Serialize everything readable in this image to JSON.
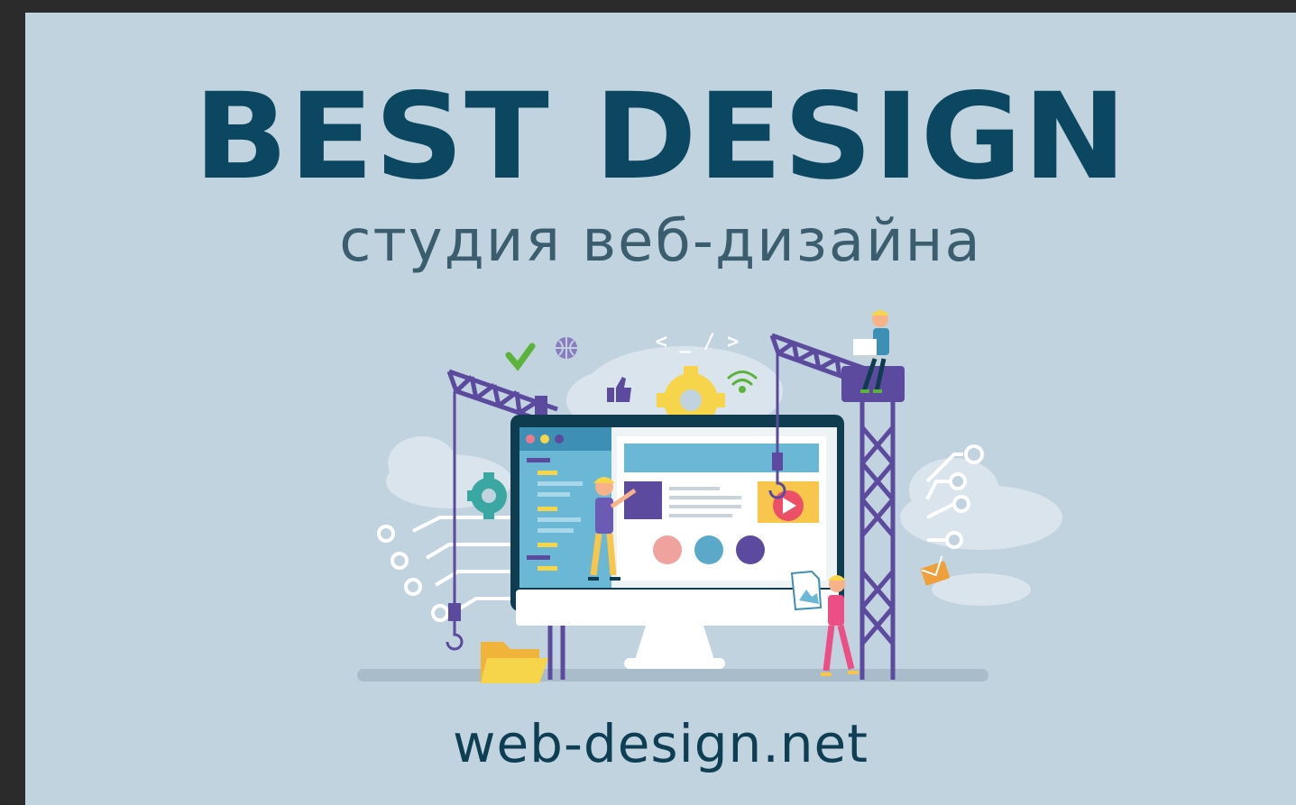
{
  "banner": {
    "title": "BEST DESIGN",
    "subtitle": "студия веб-дизайна",
    "code_tag": "< _ / >",
    "domain": "web-design.net"
  },
  "colors": {
    "background": "#c1d3df",
    "title": "#0b4760",
    "crane": "#5b4a9e",
    "monitor": "#0f3d4f",
    "accent_yellow": "#f7d54a",
    "accent_teal": "#3aa7a3",
    "accent_pink": "#ec4f86"
  },
  "icons": [
    "check-icon",
    "globe-icon",
    "thumbs-up-icon",
    "gear-icon",
    "wifi-icon",
    "play-icon",
    "folder-icon",
    "envelope-icon",
    "image-file-icon"
  ]
}
